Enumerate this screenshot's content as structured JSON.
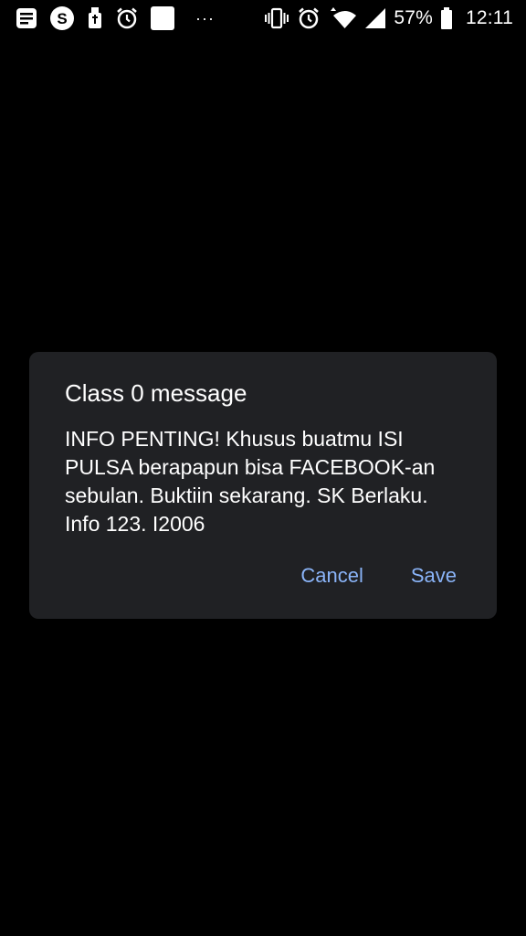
{
  "status_bar": {
    "notification_icons": [
      "notes-icon",
      "s-app-icon",
      "usb-icon",
      "alarm-icon",
      "blank-notification-icon"
    ],
    "more_indicator": "···",
    "system_icons": [
      "vibrate-icon",
      "alarm-icon",
      "wifi-icon",
      "cell-signal-icon"
    ],
    "battery_percent": "57%",
    "time": "12:11"
  },
  "dialog": {
    "title": "Class 0 message",
    "body": "INFO PENTING! Khusus buatmu ISI PULSA berapapun bisa FACEBOOK-an sebulan. Buktiin sekarang. SK Berlaku. Info 123. I2006",
    "cancel_label": "Cancel",
    "save_label": "Save"
  },
  "colors": {
    "background": "#000000",
    "dialog_surface": "#202124",
    "accent": "#8ab4f8",
    "text": "#ffffff"
  }
}
